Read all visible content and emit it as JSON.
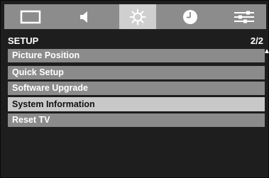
{
  "tabs": [
    {
      "icon": "picture-icon",
      "active": false
    },
    {
      "icon": "sound-icon",
      "active": false
    },
    {
      "icon": "setup-gear-icon",
      "active": true
    },
    {
      "icon": "clock-icon",
      "active": false
    },
    {
      "icon": "equalizer-icon",
      "active": false
    }
  ],
  "header": {
    "title": "SETUP",
    "page": "2/2"
  },
  "menu": {
    "items": [
      {
        "label": "Picture Position",
        "selected": false
      },
      {
        "label": "Quick Setup",
        "selected": false
      },
      {
        "label": "Software Upgrade",
        "selected": false
      },
      {
        "label": "System Information",
        "selected": true
      },
      {
        "label": "Reset TV",
        "selected": false
      }
    ]
  },
  "colors": {
    "background": "#1e1e1e",
    "tab_bar": "#8c8c8c",
    "tab_active": "#cfcfcf",
    "item": "#8b8b8b",
    "item_selected": "#c8c8c8"
  }
}
